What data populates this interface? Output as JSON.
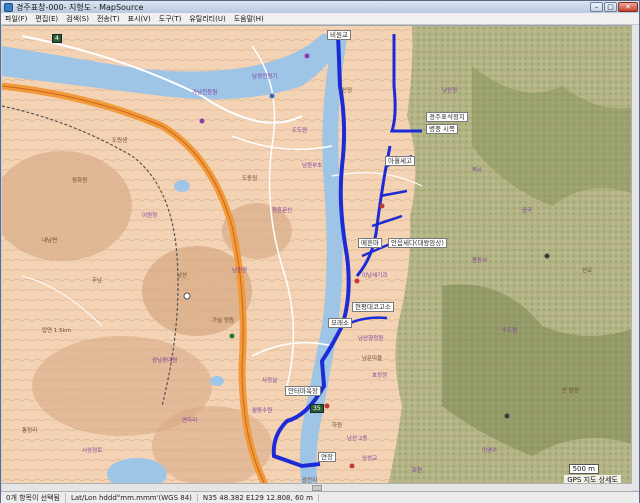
{
  "window": {
    "title": "경주표창-000- 지형도 - MapSource",
    "minimize_glyph": "–",
    "maximize_glyph": "□",
    "close_glyph": "✕"
  },
  "menu": {
    "items": [
      "파일(F)",
      "편집(E)",
      "검색(S)",
      "전송(T)",
      "표시(V)",
      "도구(T)",
      "유틸리티(U)",
      "도움말(H)"
    ]
  },
  "map": {
    "labels": {
      "station_a": "경주표석정지",
      "station_a_sub": "병중 시쪽",
      "poi_mid1": "아월세고",
      "poi_mid2": "메흔마",
      "poi_mid3": "안음세다(대왕암상)",
      "poi_mid4": "현평대코고소",
      "poi_mid5": "모래소",
      "poi_low1": "안터마옥장",
      "poi_bottom": "연장",
      "top_label": "비원교"
    },
    "road_shield_top": "4",
    "road_shield_mid": "35",
    "poi_text": [
      "남경전원기",
      "가남천등원",
      "도원생",
      "도도원",
      "도동원",
      "이원정",
      "남산",
      "남원부초",
      "탑면 1.5km",
      "정흔문산",
      "산정",
      "남산정",
      "쪽사",
      "이남세기과",
      "남산향정원",
      "남문마을",
      "사정실",
      "호정정",
      "하원",
      "남산 2동",
      "용장사",
      "광전리",
      "통정리",
      "시상정로",
      "내남면",
      "광남동대원",
      "두남",
      "연자리",
      "수도원",
      "산 밤림",
      "이영수",
      "남원장",
      "가실 정원",
      "월동수원",
      "상성교",
      "동화원",
      "응곡",
      "산오",
      "화원"
    ],
    "scale": "500 m",
    "gps_tag": "GPS 지도 상세도"
  },
  "statusbar": {
    "selection": "0개 항목이 선택됨",
    "format": "Lat/Lon hddd°mm.mmm'(WGS 84)",
    "coords": "N35 48.382 E129 12.808, 60 m"
  }
}
